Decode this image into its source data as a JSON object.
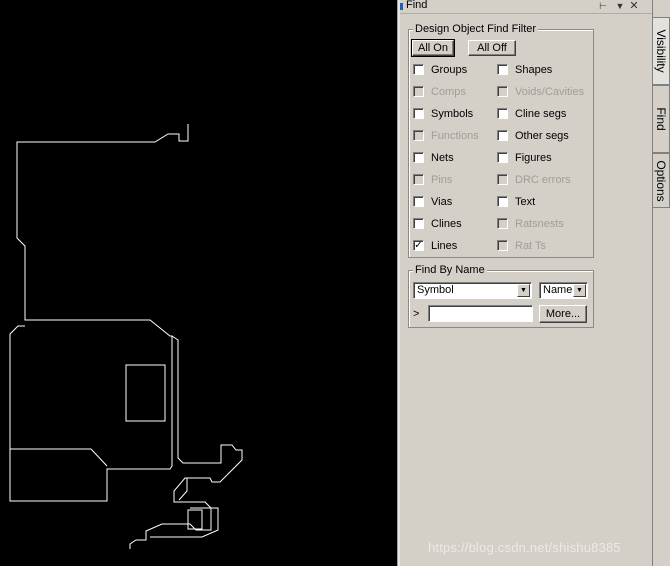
{
  "panel": {
    "title": "Find",
    "pin_icon": "pin-icon",
    "dropdown_icon": "triangle-down-icon",
    "close_icon": "close-icon"
  },
  "filter": {
    "legend": "Design Object Find Filter",
    "all_on_label": "All On",
    "all_off_label": "All Off",
    "items_left": [
      {
        "label": "Groups",
        "checked": false,
        "enabled": true
      },
      {
        "label": "Comps",
        "checked": false,
        "enabled": false
      },
      {
        "label": "Symbols",
        "checked": false,
        "enabled": true
      },
      {
        "label": "Functions",
        "checked": false,
        "enabled": false
      },
      {
        "label": "Nets",
        "checked": false,
        "enabled": true
      },
      {
        "label": "Pins",
        "checked": false,
        "enabled": false
      },
      {
        "label": "Vias",
        "checked": false,
        "enabled": true
      },
      {
        "label": "Clines",
        "checked": false,
        "enabled": true
      },
      {
        "label": "Lines",
        "checked": true,
        "enabled": true
      }
    ],
    "items_right": [
      {
        "label": "Shapes",
        "checked": false,
        "enabled": true
      },
      {
        "label": "Voids/Cavities",
        "checked": false,
        "enabled": false
      },
      {
        "label": "Cline segs",
        "checked": false,
        "enabled": true
      },
      {
        "label": "Other segs",
        "checked": false,
        "enabled": true
      },
      {
        "label": "Figures",
        "checked": false,
        "enabled": true
      },
      {
        "label": "DRC errors",
        "checked": false,
        "enabled": false
      },
      {
        "label": "Text",
        "checked": false,
        "enabled": true
      },
      {
        "label": "Ratsnests",
        "checked": false,
        "enabled": false
      },
      {
        "label": "Rat Ts",
        "checked": false,
        "enabled": false
      }
    ]
  },
  "find_by_name": {
    "legend": "Find By Name",
    "object_type": "Symbol",
    "match_mode": "Name",
    "prompt": ">",
    "input_value": "",
    "more_label": "More..."
  },
  "tabs": [
    "Visibility",
    "Find",
    "Options"
  ],
  "watermark": "https://blog.csdn.net/shishu8385",
  "colors": {
    "canvas_background": "#000000",
    "outline_stroke": "#ffffff",
    "panel_background": "#d4d0c8",
    "title_grip": "#1e5fb4"
  }
}
